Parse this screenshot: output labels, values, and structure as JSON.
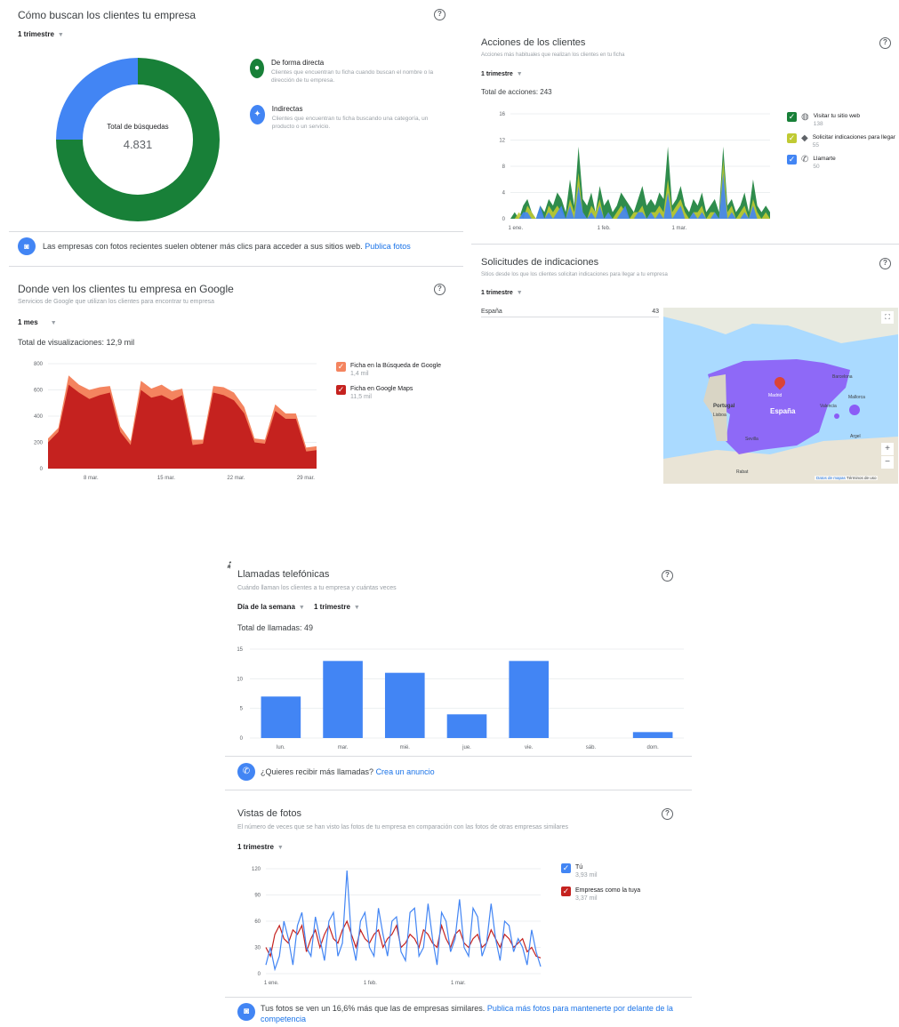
{
  "searches": {
    "title": "Cómo buscan los clientes tu empresa",
    "period": "1 trimestre",
    "total_label": "Total de búsquedas",
    "total_value": "4.831",
    "direct_fraction": 0.75,
    "legend": [
      {
        "title": "De forma directa",
        "desc": "Clientes que encuentran tu ficha cuando buscan el nombre o la dirección de tu empresa.",
        "color": "#188038"
      },
      {
        "title": "Indirectas",
        "desc": "Clientes que encuentran tu ficha buscando una categoría, un producto o un servicio.",
        "color": "#4285f4"
      }
    ]
  },
  "photo_banner": {
    "text": "Las empresas con fotos recientes suelen obtener más clics para acceder a sus sitios web.",
    "link": "Publica fotos"
  },
  "views": {
    "title": "Donde ven los clientes tu empresa en Google",
    "subtitle": "Servicios de Google que utilizan los clientes para encontrar tu empresa",
    "period": "1 mes",
    "total": "Total de visualizaciones: 12,9 mil",
    "legend": [
      {
        "label": "Ficha en la Búsqueda de Google",
        "value": "1,4 mil",
        "color": "#f4845f"
      },
      {
        "label": "Ficha en Google Maps",
        "value": "11,5 mil",
        "color": "#c5221f"
      }
    ],
    "chart_data": {
      "type": "area",
      "ylim": [
        0,
        800
      ],
      "yticks": [
        "0",
        "200",
        "400",
        "600",
        "800"
      ],
      "xticks": [
        "8 mar.",
        "15 mar.",
        "22 mar.",
        "29 mar."
      ],
      "series": [
        {
          "name": "Ficha en Google Maps",
          "values": [
            200,
            280,
            640,
            580,
            530,
            560,
            580,
            280,
            180,
            600,
            540,
            560,
            520,
            560,
            180,
            190,
            580,
            560,
            520,
            420,
            200,
            190,
            440,
            380,
            380,
            130,
            140
          ]
        },
        {
          "name": "Ficha en la Búsqueda de Google",
          "values": [
            230,
            310,
            710,
            640,
            600,
            620,
            630,
            320,
            210,
            670,
            610,
            640,
            590,
            610,
            220,
            220,
            630,
            620,
            580,
            470,
            230,
            220,
            490,
            420,
            420,
            160,
            170
          ]
        }
      ]
    }
  },
  "actions": {
    "title": "Acciones de los clientes",
    "subtitle": "Acciones más habituales que realizan los clientes en tu ficha",
    "period": "1 trimestre",
    "total": "Total de acciones: 243",
    "legend": [
      {
        "label": "Visitar tu sitio web",
        "value": "138",
        "color": "#188038",
        "icon": "globe-icon"
      },
      {
        "label": "Solicitar indicaciones para llegar",
        "value": "55",
        "color": "#c0ca33",
        "icon": "directions-icon"
      },
      {
        "label": "Llamarte",
        "value": "50",
        "color": "#4285f4",
        "icon": "phone-icon"
      }
    ],
    "chart_data": {
      "type": "area",
      "ylim": [
        0,
        16
      ],
      "yticks": [
        "0",
        "4",
        "8",
        "12",
        "16"
      ],
      "xticks": [
        "1 ene.",
        "1 feb.",
        "1 mar."
      ],
      "series": [
        {
          "name": "Visitar tu sitio web",
          "values": [
            0,
            1,
            0,
            2,
            3,
            1,
            0,
            2,
            1,
            3,
            2,
            4,
            3,
            1,
            6,
            2,
            11,
            3,
            2,
            4,
            1,
            5,
            2,
            3,
            1,
            2,
            4,
            3,
            2,
            1,
            3,
            5,
            2,
            3,
            2,
            4,
            3,
            11,
            2,
            3,
            5,
            2,
            1,
            3,
            2,
            4,
            1,
            2,
            3,
            1,
            11,
            2,
            3,
            1,
            2,
            4,
            1,
            6,
            2,
            1,
            2,
            1
          ]
        },
        {
          "name": "Solicitar indicaciones para llegar",
          "values": [
            0,
            0,
            1,
            0,
            2,
            1,
            0,
            1,
            0,
            2,
            1,
            2,
            1,
            0,
            3,
            1,
            7,
            1,
            0,
            2,
            1,
            3,
            0,
            1,
            0,
            1,
            2,
            1,
            0,
            1,
            1,
            2,
            0,
            1,
            1,
            2,
            1,
            6,
            1,
            2,
            3,
            1,
            0,
            1,
            1,
            2,
            0,
            1,
            1,
            0,
            9,
            1,
            2,
            0,
            1,
            2,
            0,
            3,
            1,
            0,
            1,
            0
          ]
        },
        {
          "name": "Llamarte",
          "values": [
            0,
            0,
            0,
            1,
            1,
            0,
            0,
            2,
            0,
            1,
            0,
            1,
            2,
            0,
            2,
            0,
            5,
            1,
            0,
            1,
            0,
            2,
            0,
            1,
            0,
            0,
            1,
            2,
            0,
            0,
            1,
            1,
            0,
            1,
            0,
            1,
            0,
            4,
            0,
            1,
            2,
            0,
            0,
            1,
            0,
            1,
            0,
            0,
            1,
            0,
            7,
            0,
            1,
            0,
            0,
            1,
            0,
            2,
            0,
            0,
            0,
            0
          ]
        }
      ]
    }
  },
  "directions": {
    "title": "Solicitudes de indicaciones",
    "subtitle": "Sitios desde los que los clientes solicitan indicaciones para llegar a tu empresa",
    "period": "1 trimestre",
    "rows": [
      {
        "place": "España",
        "count": "43"
      }
    ],
    "map": {
      "labels": [
        "España",
        "Portugal",
        "Lisboa",
        "Sevilla",
        "Madrid",
        "Valencia",
        "Barcelona",
        "Mallorca",
        "Argel",
        "Rabat"
      ],
      "zoom_in": "+",
      "zoom_out": "−",
      "footer": [
        "Datos de mapas",
        "Términos de uso"
      ],
      "highlight_color": "#8b5cf6",
      "water_color": "#aadaff"
    }
  },
  "calls": {
    "title": "Llamadas telefónicas",
    "subtitle": "Cuándo llaman los clientes a tu empresa y cuántas veces",
    "filter1": "Día de la semana",
    "filter2": "1 trimestre",
    "total": "Total de llamadas: 49",
    "chart_data": {
      "type": "bar",
      "categories": [
        "lun.",
        "mar.",
        "mié.",
        "jue.",
        "vie.",
        "sáb.",
        "dom."
      ],
      "values": [
        7,
        13,
        11,
        4,
        13,
        0,
        1
      ],
      "ylim": [
        0,
        15
      ],
      "yticks": [
        "0",
        "5",
        "10",
        "15"
      ],
      "color": "#4285f4"
    },
    "banner_text": "¿Quieres recibir más llamadas?",
    "banner_link": "Crea un anuncio"
  },
  "photos": {
    "title": "Vistas de fotos",
    "subtitle": "El número de veces que se han visto las fotos de tu empresa en comparación con las fotos de otras empresas similares",
    "period": "1 trimestre",
    "legend": [
      {
        "label": "Tú",
        "value": "3,93 mil",
        "color": "#4285f4"
      },
      {
        "label": "Empresas como la tuya",
        "value": "3,37 mil",
        "color": "#c5221f"
      }
    ],
    "chart_data": {
      "type": "line",
      "ylim": [
        0,
        120
      ],
      "yticks": [
        "0",
        "30",
        "60",
        "90",
        "120"
      ],
      "xticks": [
        "1 ene.",
        "1 feb.",
        "1 mar."
      ],
      "series": [
        {
          "name": "Tú",
          "values": [
            10,
            30,
            5,
            20,
            60,
            40,
            10,
            55,
            70,
            30,
            20,
            65,
            40,
            15,
            60,
            70,
            20,
            35,
            118,
            40,
            15,
            60,
            70,
            30,
            20,
            75,
            45,
            20,
            60,
            65,
            25,
            15,
            70,
            75,
            20,
            30,
            80,
            40,
            10,
            70,
            60,
            25,
            40,
            85,
            30,
            20,
            75,
            65,
            20,
            35,
            80,
            40,
            15,
            60,
            55,
            25,
            40,
            30,
            10,
            50,
            25,
            8
          ]
        },
        {
          "name": "Empresas como la tuya",
          "values": [
            30,
            20,
            45,
            55,
            40,
            35,
            50,
            45,
            55,
            25,
            40,
            50,
            30,
            45,
            55,
            40,
            35,
            50,
            60,
            45,
            30,
            50,
            40,
            35,
            45,
            50,
            30,
            40,
            45,
            55,
            30,
            35,
            45,
            40,
            30,
            50,
            45,
            35,
            30,
            55,
            40,
            30,
            45,
            50,
            35,
            30,
            40,
            45,
            30,
            35,
            50,
            40,
            30,
            45,
            40,
            30,
            35,
            40,
            25,
            30,
            20,
            18
          ]
        }
      ]
    },
    "banner_text": "Tus fotos se ven un 16,6% más que las de empresas similares.",
    "banner_link": "Publica más fotos para mantenerte por delante de la competencia"
  }
}
